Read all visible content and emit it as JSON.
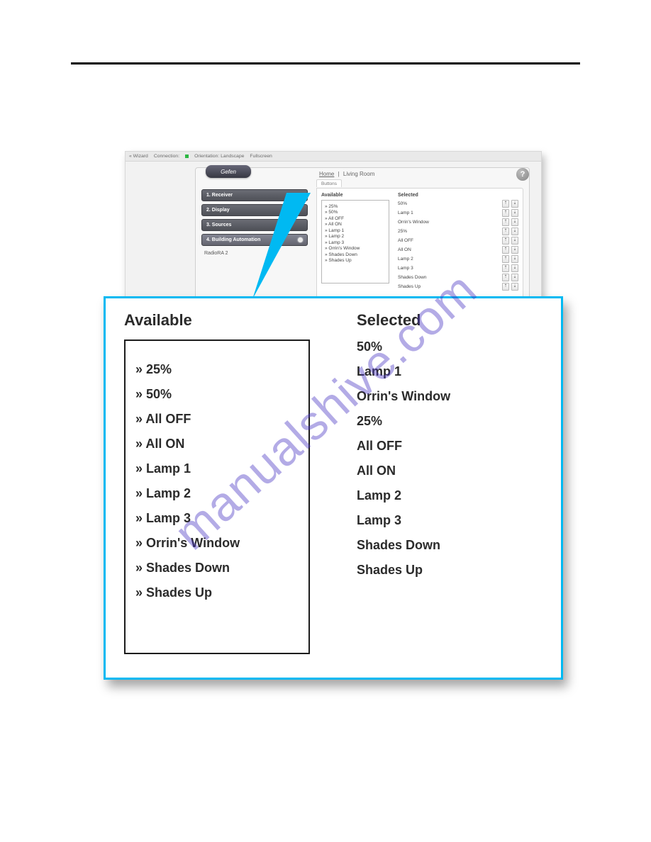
{
  "topbar": {
    "wizard": "« Wizard",
    "connection_label": "Connection:",
    "orientation": "Orientation: Landscape",
    "fullscreen": "Fullscreen"
  },
  "brand": "Gefen",
  "breadcrumb": {
    "home": "Home",
    "sep": "|",
    "room": "Living Room"
  },
  "tab": "Buttons",
  "help": "?",
  "sidebar": {
    "items": [
      "1. Receiver",
      "2. Display",
      "3. Sources",
      "4. Building Automation"
    ],
    "sub": "RadioRA 2"
  },
  "list_headers": {
    "available": "Available",
    "selected": "Selected"
  },
  "available_items": [
    "» 25%",
    "» 50%",
    "» All OFF",
    "» All ON",
    "» Lamp 1",
    "» Lamp 2",
    "» Lamp 3",
    "» Orrin's Window",
    "» Shades Down",
    "» Shades Up"
  ],
  "selected_items": [
    "50%",
    "Lamp 1",
    "Orrin's Window",
    "25%",
    "All OFF",
    "All ON",
    "Lamp 2",
    "Lamp 3",
    "Shades Down",
    "Shades Up"
  ],
  "arrows": {
    "up": "⇡",
    "down": "⇣"
  },
  "watermark": "manualshive.com"
}
